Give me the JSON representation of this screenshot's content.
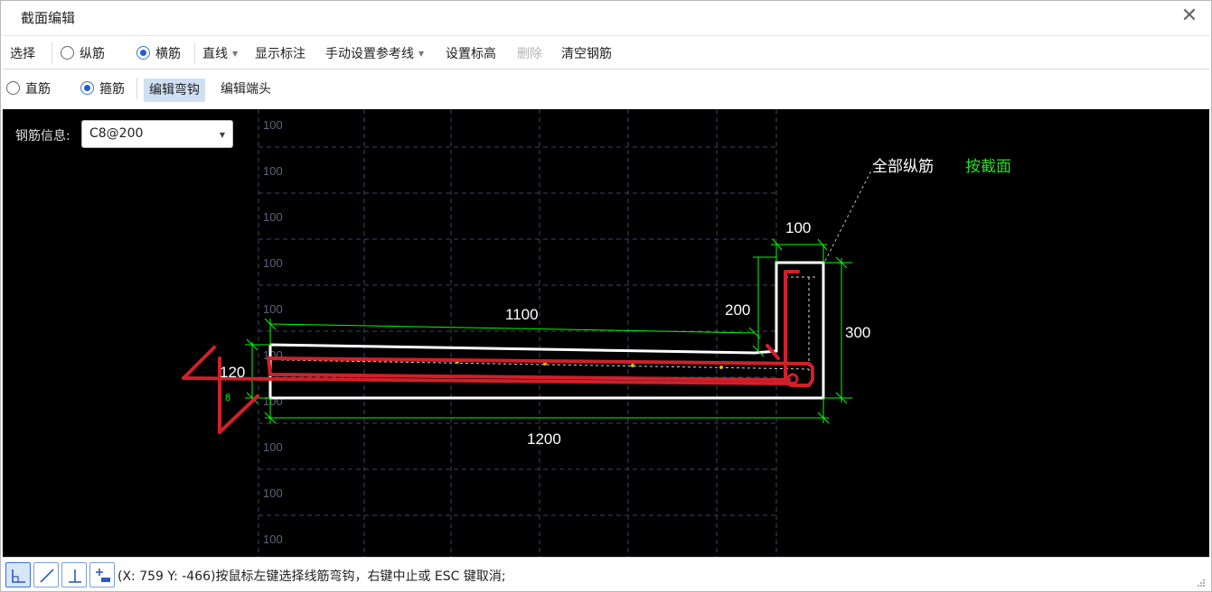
{
  "window": {
    "title": "截面编辑",
    "close_glyph": "✕"
  },
  "toolbar1": {
    "select": "选择",
    "longitudinal": "纵筋",
    "transverse": "横筋",
    "line": "直线",
    "show_dims": "显示标注",
    "manual_ref": "手动设置参考线",
    "set_elevation": "设置标高",
    "delete": "删除",
    "clear_rebar": "清空钢筋",
    "dropdown_glyph": "▼"
  },
  "toolbar2": {
    "straight": "直筋",
    "stirrup": "箍筋",
    "edit_hook": "编辑弯钩",
    "edit_end": "编辑端头"
  },
  "canvas": {
    "rebar_info_label": "钢筋信息:",
    "rebar_info_value": "C8@200",
    "dropdown_glyph": "▼",
    "grid_labels": [
      "100",
      "100",
      "100",
      "100",
      "100",
      "100",
      "100",
      "100",
      "100",
      "100"
    ],
    "dims": {
      "d100": "100",
      "d200": "200",
      "d300": "300",
      "d1100": "1100",
      "d1200": "1200",
      "d120": "120",
      "d8": "8"
    },
    "annotation_all": "全部纵筋",
    "annotation_mode": "按截面",
    "colors": {
      "bg": "#000000",
      "outline": "#ffffff",
      "dim": "#00ff00",
      "rebar": "#d0202a",
      "grid": "#3c4660",
      "mode_text": "#22dd22"
    }
  },
  "statusbar": {
    "snap_buttons": [
      "orthogonal-snap-icon",
      "oblique-line-icon",
      "perpendicular-icon",
      "add-point-icon"
    ],
    "message": "(X: 759 Y: -466)按鼠标左键选择线筋弯钩，右键中止或 ESC 键取消;"
  }
}
